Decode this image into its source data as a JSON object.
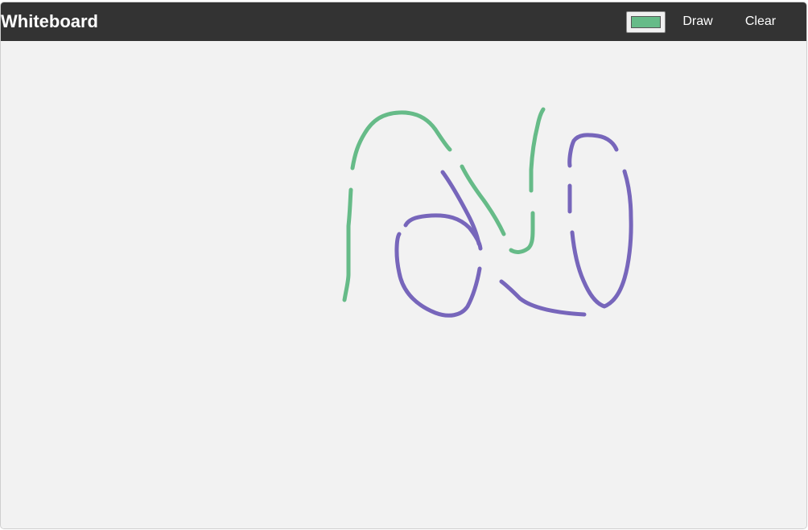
{
  "app": {
    "title": "Whiteboard"
  },
  "toolbar": {
    "color_picker": {
      "icon": "color-swatch",
      "selected_color": "#66bb88"
    },
    "draw_label": "Draw",
    "clear_label": "Clear"
  },
  "canvas": {
    "background_color": "#f2f2f2",
    "stroke_colors": {
      "green": "#66bb88",
      "purple": "#7766bb"
    }
  }
}
